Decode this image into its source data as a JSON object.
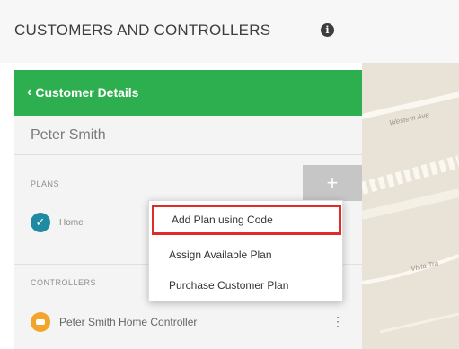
{
  "page": {
    "title": "CUSTOMERS AND CONTROLLERS"
  },
  "panel": {
    "back_label": "Customer Details",
    "customer_name": "Peter Smith",
    "plans_label": "PLANS",
    "add_label": "+",
    "plans": [
      {
        "name": "Home",
        "status_icon": "check-icon"
      }
    ],
    "controllers_label": "CONTROLLERS",
    "controllers": [
      {
        "name": "Peter Smith Home Controller"
      }
    ]
  },
  "dropdown": {
    "items": [
      {
        "label": "Add Plan using Code",
        "highlighted": true
      },
      {
        "label": "Assign Available Plan",
        "highlighted": false
      },
      {
        "label": "Purchase Customer Plan",
        "highlighted": false
      }
    ]
  },
  "map": {
    "streets": [
      "Western Ave",
      "Vista Tra"
    ]
  },
  "colors": {
    "header_green": "#2eaf4f",
    "check_blue": "#1e8aa3",
    "controller_orange": "#f2a52a",
    "highlight_red": "#e02b2b"
  }
}
